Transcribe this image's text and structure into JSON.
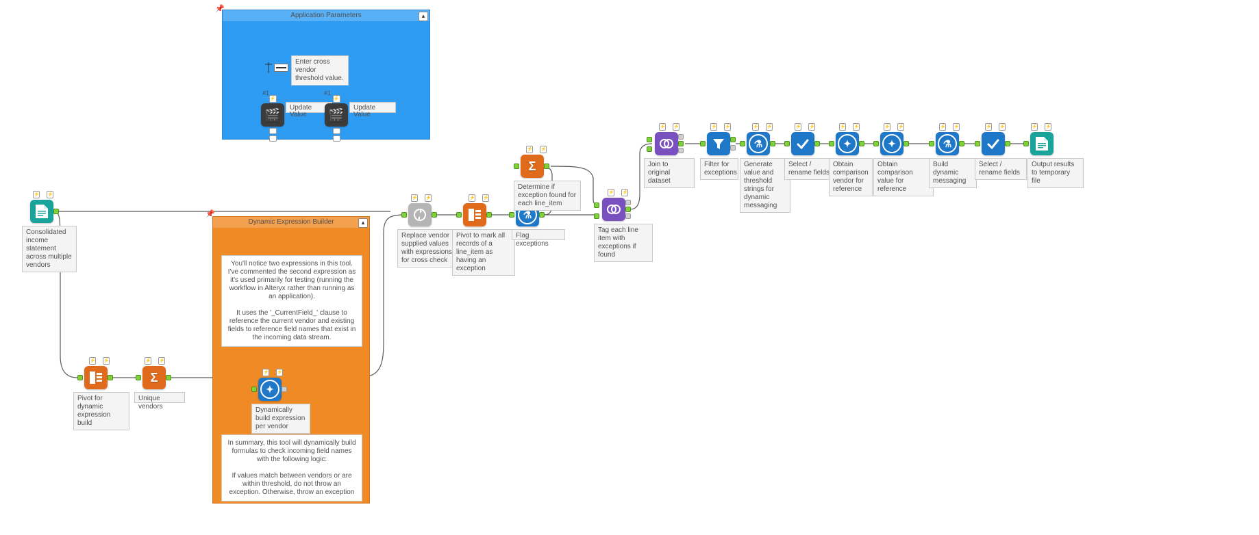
{
  "containers": {
    "app_params": {
      "title": "Application Parameters",
      "textbox_caption": "Enter cross vendor threshold value.",
      "anchor1_label": "#1",
      "anchor2_label": "#1",
      "action1_caption": "Update Value",
      "action2_caption": "Update Value"
    },
    "dyn_expr": {
      "title": "Dynamic Expression Builder",
      "comment1": "You'll notice two expressions in this tool. I've commented the second expression as it's used primarily for testing (running the workflow in Alteryx rather than running as an application).\n\nIt uses the '_CurrentField_' clause to reference the current vendor and existing fields to reference field names that exist in the incoming data stream.",
      "tool_caption": "Dynamically build expression per vendor",
      "comment2": "In summary, this tool will dynamically build formulas to check incoming field names with the following logic:\n\nIf values match between vendors or are within threshold, do not throw an exception. Otherwise, throw an exception"
    }
  },
  "tools": {
    "input": {
      "label": "Consolidated income statement across multiple vendors"
    },
    "transpose1": {
      "label": "Pivot for dynamic expression build"
    },
    "summarize_vendors": {
      "label": "Unique vendors"
    },
    "multifield_formula": {
      "label": "Dynamically build expression per vendor"
    },
    "multirow": {
      "label": "Replace vendor supplied values with expressions for cross check"
    },
    "transpose2": {
      "label": "Pivot to mark all records of a line_item as having an exception"
    },
    "formula_flag": {
      "label": "Flag exceptions"
    },
    "summarize_exc": {
      "label": "Determine if exception found for each line_item"
    },
    "join_tag": {
      "label": "Tag each line item with exceptions if found"
    },
    "join_original": {
      "label": "Join to original dataset"
    },
    "filter": {
      "label": "Filter for exceptions"
    },
    "formula_gen": {
      "label": "Generate value and threshold strings for dynamic messaging"
    },
    "select1": {
      "label": "Select / rename fields"
    },
    "mff_compare_vendor": {
      "label": "Obtain comparison vendor for reference"
    },
    "mff_compare_value": {
      "label": "Obtain comparison value for reference"
    },
    "formula_msg": {
      "label": "Build dynamic messaging"
    },
    "select2": {
      "label": "Select / rename fields"
    },
    "output": {
      "label": "Output results to temporary file"
    }
  },
  "colors": {
    "app_params_bg": "#2f9cf4",
    "dyn_expr_bg": "#f08a24",
    "wire": "#5a5a5a",
    "anchor_green": "#7fd23a"
  }
}
